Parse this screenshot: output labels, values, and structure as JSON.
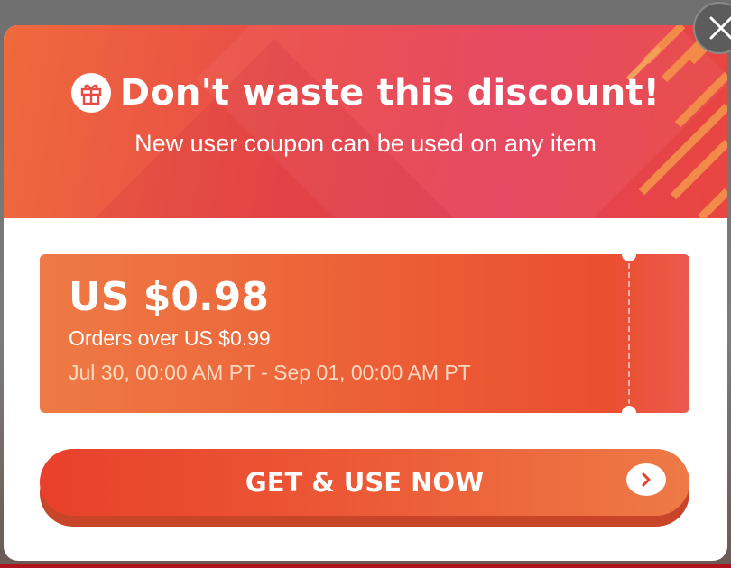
{
  "header": {
    "title": "Don't waste this discount!",
    "subtitle": "New user coupon can be used on any item",
    "gift_icon": "gift-icon"
  },
  "coupon": {
    "amount": "US $0.98",
    "min_order": "Orders over US $0.99",
    "validity": "Jul 30, 00:00 AM PT - Sep 01, 00:00 AM PT"
  },
  "cta": {
    "label": "GET & USE NOW",
    "arrow_icon": "chevron-right-icon"
  },
  "close": {
    "icon": "close-icon"
  },
  "colors": {
    "header_gradient_start": "#ee6a3c",
    "header_gradient_end": "#e5405a",
    "coupon_orange": "#ec5b34",
    "cta_red": "#e8402b",
    "cta_orange": "#ee7a46"
  }
}
